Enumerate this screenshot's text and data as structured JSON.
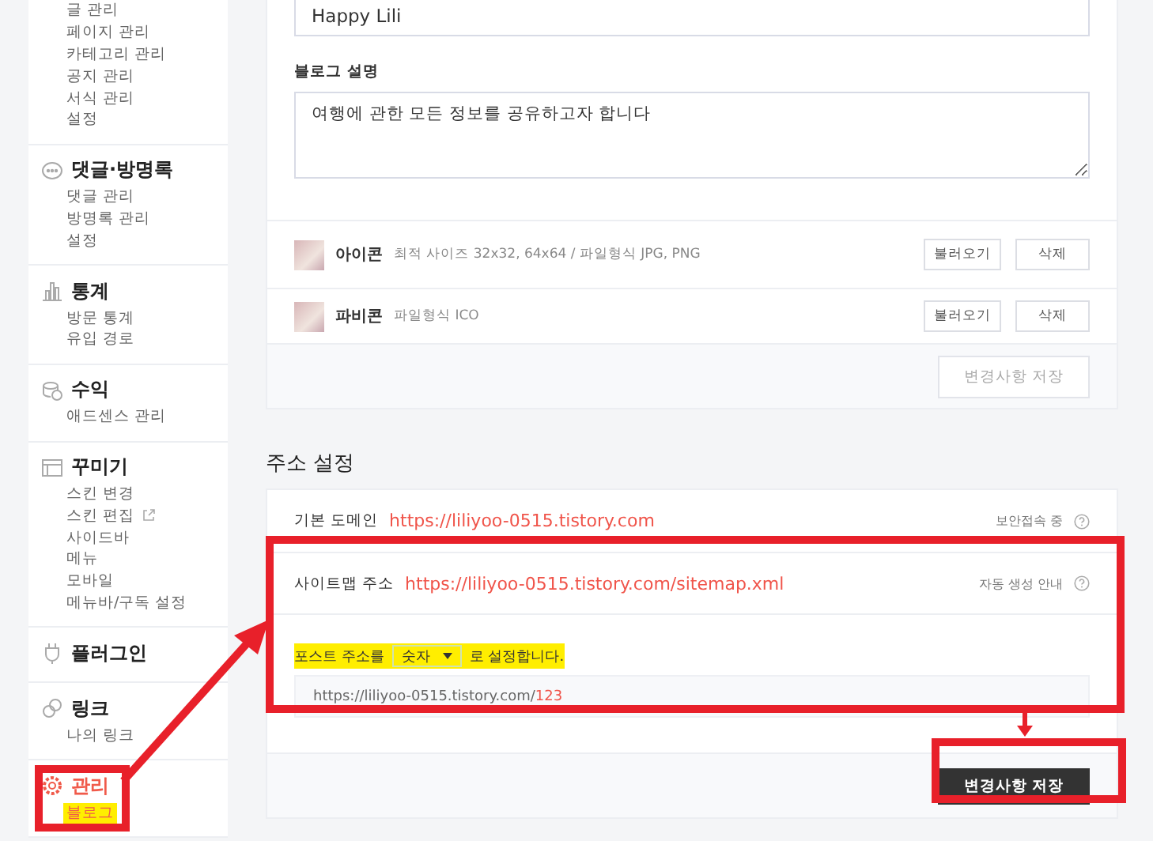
{
  "sidebar": {
    "sections": [
      {
        "items": [
          {
            "label": "글 관리",
            "selected": false,
            "highlighted": false
          },
          {
            "label": "페이지 관리",
            "selected": false,
            "highlighted": false
          },
          {
            "label": "카테고리 관리",
            "selected": false,
            "highlighted": false
          },
          {
            "label": "공지 관리",
            "selected": false,
            "highlighted": false
          },
          {
            "label": "서식 관리",
            "selected": false,
            "highlighted": false
          },
          {
            "label": "설정",
            "selected": false,
            "highlighted": false
          }
        ]
      },
      {
        "title": "댓글·방명록",
        "active": false,
        "items": [
          {
            "label": "댓글 관리",
            "selected": false,
            "highlighted": false
          },
          {
            "label": "방명록 관리",
            "selected": false,
            "highlighted": false
          },
          {
            "label": "설정",
            "selected": false,
            "highlighted": false
          }
        ]
      },
      {
        "title": "통계",
        "active": false,
        "items": [
          {
            "label": "방문 통계",
            "selected": false,
            "highlighted": false
          },
          {
            "label": "유입 경로",
            "selected": false,
            "highlighted": false
          }
        ]
      },
      {
        "title": "수익",
        "active": false,
        "items": [
          {
            "label": "애드센스 관리",
            "selected": false,
            "highlighted": false
          }
        ]
      },
      {
        "title": "꾸미기",
        "active": false,
        "items": [
          {
            "label": "스킨 변경",
            "selected": false,
            "highlighted": false
          },
          {
            "label": "스킨 편집",
            "selected": false,
            "highlighted": false,
            "external": true
          },
          {
            "label": "사이드바",
            "selected": false,
            "highlighted": false
          },
          {
            "label": "메뉴",
            "selected": false,
            "highlighted": false
          },
          {
            "label": "모바일",
            "selected": false,
            "highlighted": false
          },
          {
            "label": "메뉴바/구독 설정",
            "selected": false,
            "highlighted": false
          }
        ]
      },
      {
        "title": "플러그인",
        "active": false
      },
      {
        "title": "링크",
        "active": false,
        "items": [
          {
            "label": "나의 링크",
            "selected": false,
            "highlighted": false
          }
        ]
      },
      {
        "title": "관리",
        "active": true,
        "items": [
          {
            "label": "블로그",
            "selected": true,
            "highlighted": true
          }
        ]
      }
    ]
  },
  "blog_info": {
    "name_value": "Happy Lili",
    "description_label": "블로그 설명",
    "description_value": "여행에 관한 모든 정보를 공유하고자 합니다",
    "images": [
      {
        "label": "아이콘",
        "hint": "최적 사이즈 32x32, 64x64 / 파일형식 JPG, PNG",
        "buttons": [
          "불러오기",
          "삭제"
        ]
      },
      {
        "label": "파비콘",
        "hint": "파일형식 ICO",
        "buttons": [
          "불러오기",
          "삭제"
        ]
      }
    ],
    "save_button": {
      "label": "변경사항 저장",
      "disabled": true
    }
  },
  "address": {
    "heading": "주소 설정",
    "rows": [
      {
        "label": "기본 도메인",
        "url": "https://liliyoo-0515.tistory.com",
        "help": "보안접속 중"
      },
      {
        "label": "사이트맵 주소",
        "url": "https://liliyoo-0515.tistory.com/sitemap.xml",
        "help": "자동 생성 안내"
      }
    ],
    "post_address": {
      "prefix": "포스트 주소를",
      "select_value": "숫자",
      "suffix": "로 설정합니다.",
      "highlighted": true,
      "example_base": "https://liliyoo-0515.tistory.com/",
      "example_suffix": "123"
    },
    "save_button": {
      "label": "변경사항 저장",
      "disabled": false
    }
  }
}
